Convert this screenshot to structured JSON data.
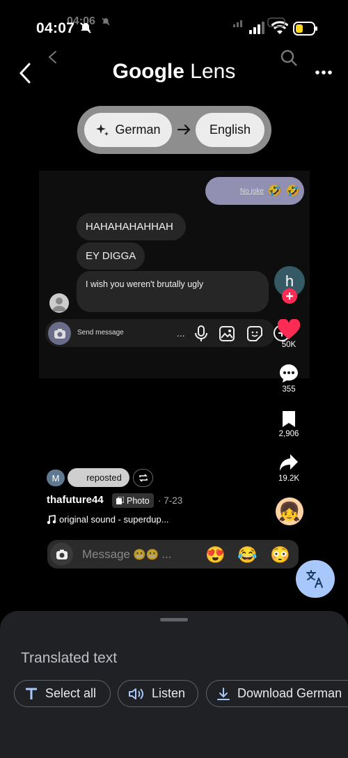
{
  "status_bar": {
    "time": "04:07",
    "time_ghost": "04:06"
  },
  "header": {
    "title_google": "Google",
    "title_lens": " Lens"
  },
  "language": {
    "source": "German",
    "target": "English"
  },
  "chat": {
    "sent_message": "No joke",
    "messages": [
      "HAHAHAHAHHAH",
      "EY DIGGA",
      "I wish you weren't brutally ugly"
    ],
    "input_placeholder": "Send message",
    "more_dots": "..."
  },
  "side_actions": {
    "likes": "50K",
    "comments": "355",
    "bookmarks": "2,906",
    "shares": "19.2K",
    "profile_initial": "h"
  },
  "post": {
    "repost_initial": "M",
    "repost_label": "reposted",
    "username": "thafuture44",
    "photo_badge": "Photo",
    "date": "· 7-23",
    "sound": "original sound - superdup..."
  },
  "message_bar": {
    "placeholder": "Message",
    "emojis": [
      "😍",
      "😂",
      "😳"
    ]
  },
  "sheet": {
    "title": "Translated text",
    "chips": {
      "select_all": "Select all",
      "listen": "Listen",
      "download": "Download German"
    }
  },
  "colors": {
    "accent_blue": "#a8c7fa",
    "like_red": "#fe2c55",
    "sheet_bg": "#202124"
  }
}
